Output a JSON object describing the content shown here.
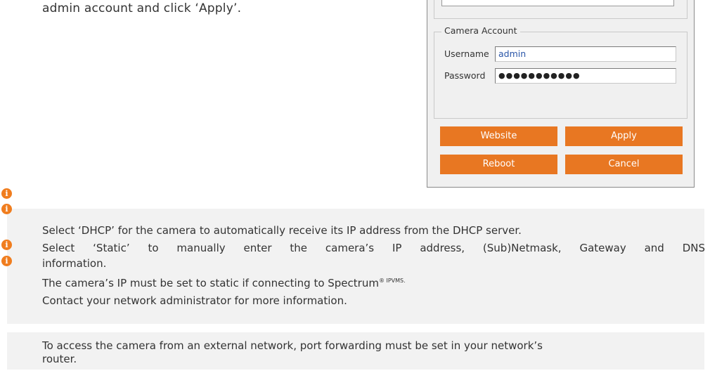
{
  "intro_text": "admin account and click ‘Apply’.",
  "dialog": {
    "camera_account": {
      "title": "Camera Account",
      "username_label": "Username",
      "username_value": "admin",
      "password_label": "Password",
      "password_value": "●●●●●●●●●●●"
    },
    "buttons": {
      "website": "Website",
      "apply": "Apply",
      "reboot": "Reboot",
      "cancel": "Cancel"
    }
  },
  "icons": {
    "info_glyph": "i",
    "accent_color": "#e87722"
  },
  "notes": {
    "network": [
      "Select ‘DHCP’ for the camera to automatically receive its IP address from the DHCP server.",
      "Select ‘Static’ to manually enter the camera’s IP address, (Sub)Netmask, Gateway and DNS",
      "information.",
      "The camera’s IP must be set to static if connecting to Spectrum",
      "® IPVMS.",
      "Contact your network administrator for more information."
    ],
    "port_forwarding": [
      "To access the camera from an external network, port forwarding must be set in your network’s",
      "router."
    ]
  }
}
